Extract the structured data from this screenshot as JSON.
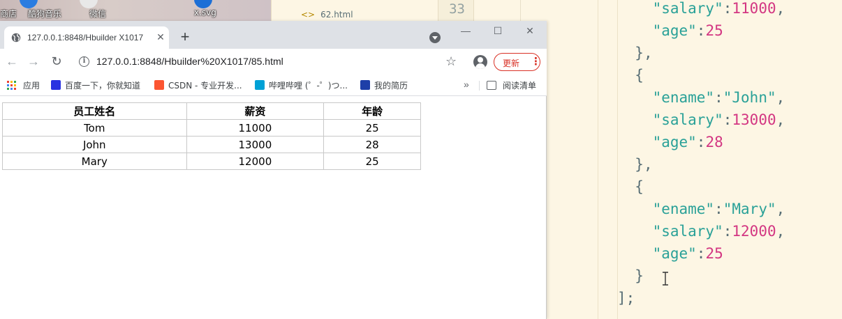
{
  "desktop": {
    "items": [
      "商店",
      "酷狗音乐",
      "微信",
      "x.svg"
    ]
  },
  "middle_editor": {
    "file_name": "62.html",
    "line_number": "33"
  },
  "code": {
    "lines": [
      {
        "t": "    \"salary\":11000,"
      },
      {
        "t": "    \"age\":25"
      },
      {
        "t": "  },"
      },
      {
        "t": "  {"
      },
      {
        "t": "    \"ename\":\"John\","
      },
      {
        "t": "    \"salary\":13000,"
      },
      {
        "t": "    \"age\":28"
      },
      {
        "t": "  },"
      },
      {
        "t": "  {"
      },
      {
        "t": "    \"ename\":\"Mary\","
      },
      {
        "t": "    \"salary\":12000,"
      },
      {
        "t": "    \"age\":25"
      },
      {
        "t": "  }"
      },
      {
        "t": "];"
      }
    ]
  },
  "browser": {
    "tab_title": "127.0.0.1:8848/Hbuilder X1017",
    "new_tab": "+",
    "window_buttons": {
      "minimize": "—",
      "maximize": "☐",
      "close": "✕"
    },
    "url": "127.0.0.1:8848/Hbuilder%20X1017/85.html",
    "update_label": "更新",
    "bookmarks": [
      {
        "label": "应用",
        "icon": "apps-grid-icon"
      },
      {
        "label": "百度一下，你就知道",
        "icon": "baidu-icon",
        "color": "#2932e1"
      },
      {
        "label": "CSDN - 专业开发...",
        "icon": "csdn-icon",
        "color": "#fc5531"
      },
      {
        "label": "哔哩哔哩 (゜-゜)つ...",
        "icon": "bilibili-icon",
        "color": "#00a1d6"
      },
      {
        "label": "我的简历",
        "icon": "resume-icon",
        "color": "#1e3fa8"
      }
    ],
    "bookmarks_more": "»",
    "reading_list": "阅读清单"
  },
  "table": {
    "headers": [
      "员工姓名",
      "薪资",
      "年龄"
    ],
    "rows": [
      [
        "Tom",
        "11000",
        "25"
      ],
      [
        "John",
        "13000",
        "28"
      ],
      [
        "Mary",
        "12000",
        "25"
      ]
    ]
  }
}
